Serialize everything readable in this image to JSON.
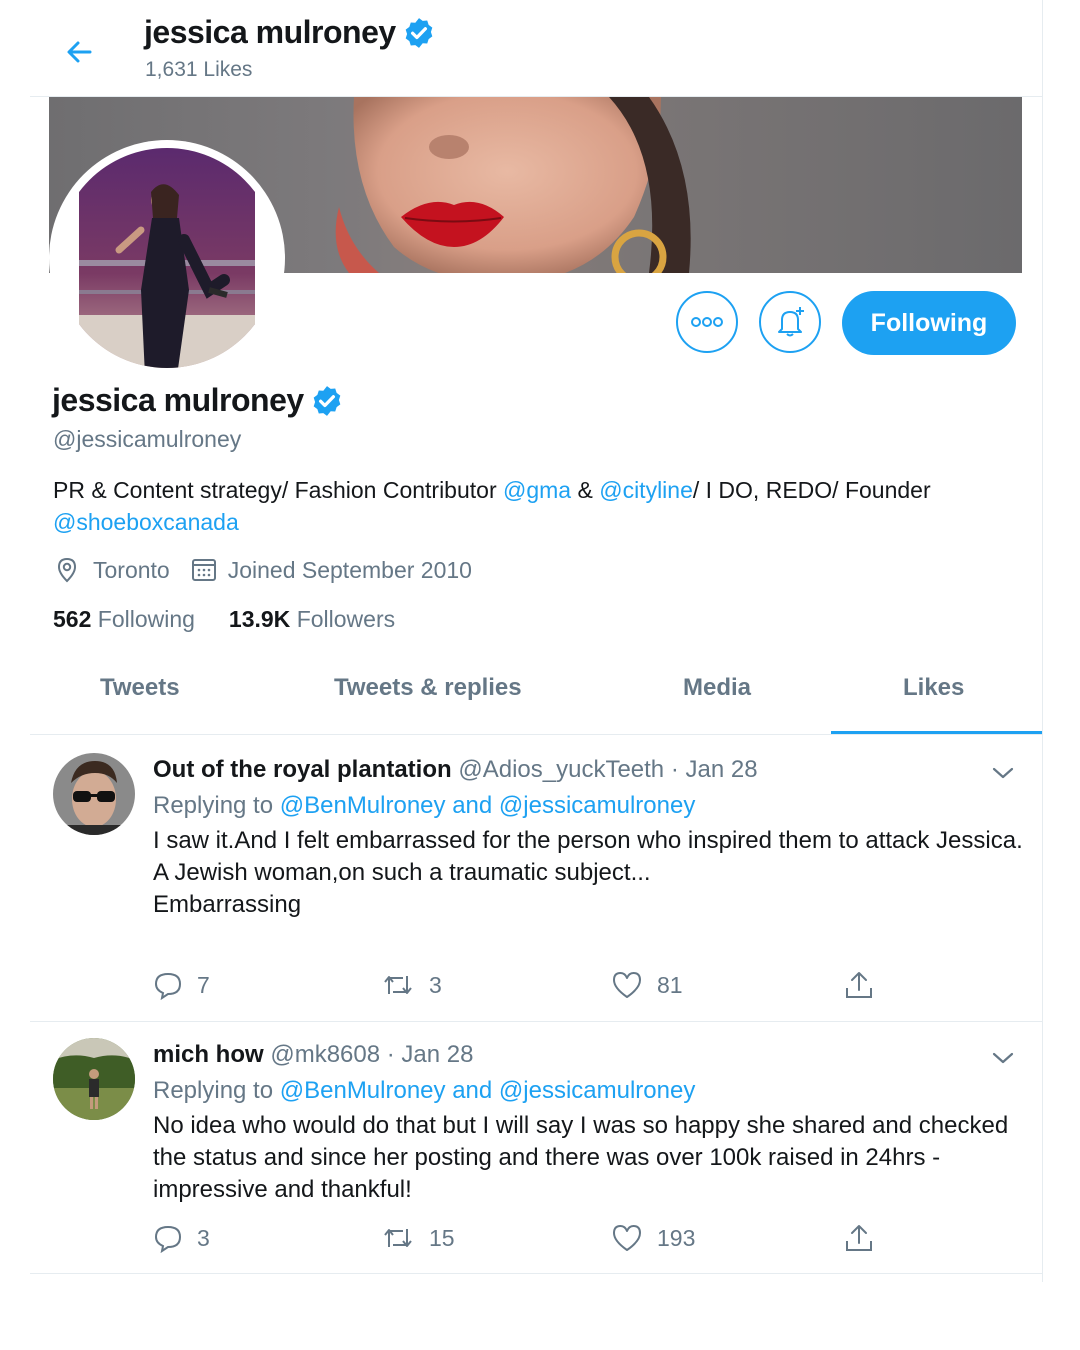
{
  "header": {
    "name": "jessica mulroney",
    "likes_count": "1,631 Likes"
  },
  "profile": {
    "name": "jessica mulroney",
    "handle": "@jessicamulroney",
    "bio": {
      "part1": "PR & Content strategy/ Fashion Contributor ",
      "mention1": "@gma",
      "part2": " & ",
      "mention2": "@cityline",
      "part3": "/ I DO, REDO/ Founder ",
      "mention3": "@shoeboxcanada"
    },
    "location": "Toronto",
    "joined": "Joined September 2010",
    "following_count": "562",
    "following_label": "Following",
    "followers_count": "13.9K",
    "followers_label": "Followers",
    "follow_button": "Following"
  },
  "tabs": [
    {
      "label": "Tweets"
    },
    {
      "label": "Tweets & replies"
    },
    {
      "label": "Media"
    },
    {
      "label": "Likes",
      "active": true
    }
  ],
  "tweets": [
    {
      "name": "Out of the royal plantation",
      "handle": "@Adios_yuckTeeth",
      "date": "· Jan 28",
      "replying_prefix": "Replying to",
      "replying_to": "@BenMulroney and @jessicamulroney",
      "text": "I saw it.And I felt embarrassed for the person who inspired them to attack Jessica.\nA Jewish woman,on such a traumatic subject...\nEmbarrassing",
      "replies": "7",
      "retweets": "3",
      "likes": "81"
    },
    {
      "name": "mich how",
      "handle": "@mk8608",
      "date": "· Jan 28",
      "replying_prefix": "Replying to",
      "replying_to": "@BenMulroney and @jessicamulroney",
      "text": "No idea who would do that but I will say I was so happy she shared and checked the status and since her posting and there was over 100k raised in 24hrs - impressive and thankful!",
      "replies": "3",
      "retweets": "15",
      "likes": "193"
    }
  ],
  "colors": {
    "accent": "#1da1f2",
    "secondary_text": "#657786",
    "border": "#e6ecf0"
  },
  "icons": [
    "back-arrow-icon",
    "verified-badge-icon",
    "more-icon",
    "notification-bell-icon",
    "location-pin-icon",
    "calendar-icon",
    "reply-icon",
    "retweet-icon",
    "like-icon",
    "share-icon",
    "chevron-down-icon"
  ]
}
